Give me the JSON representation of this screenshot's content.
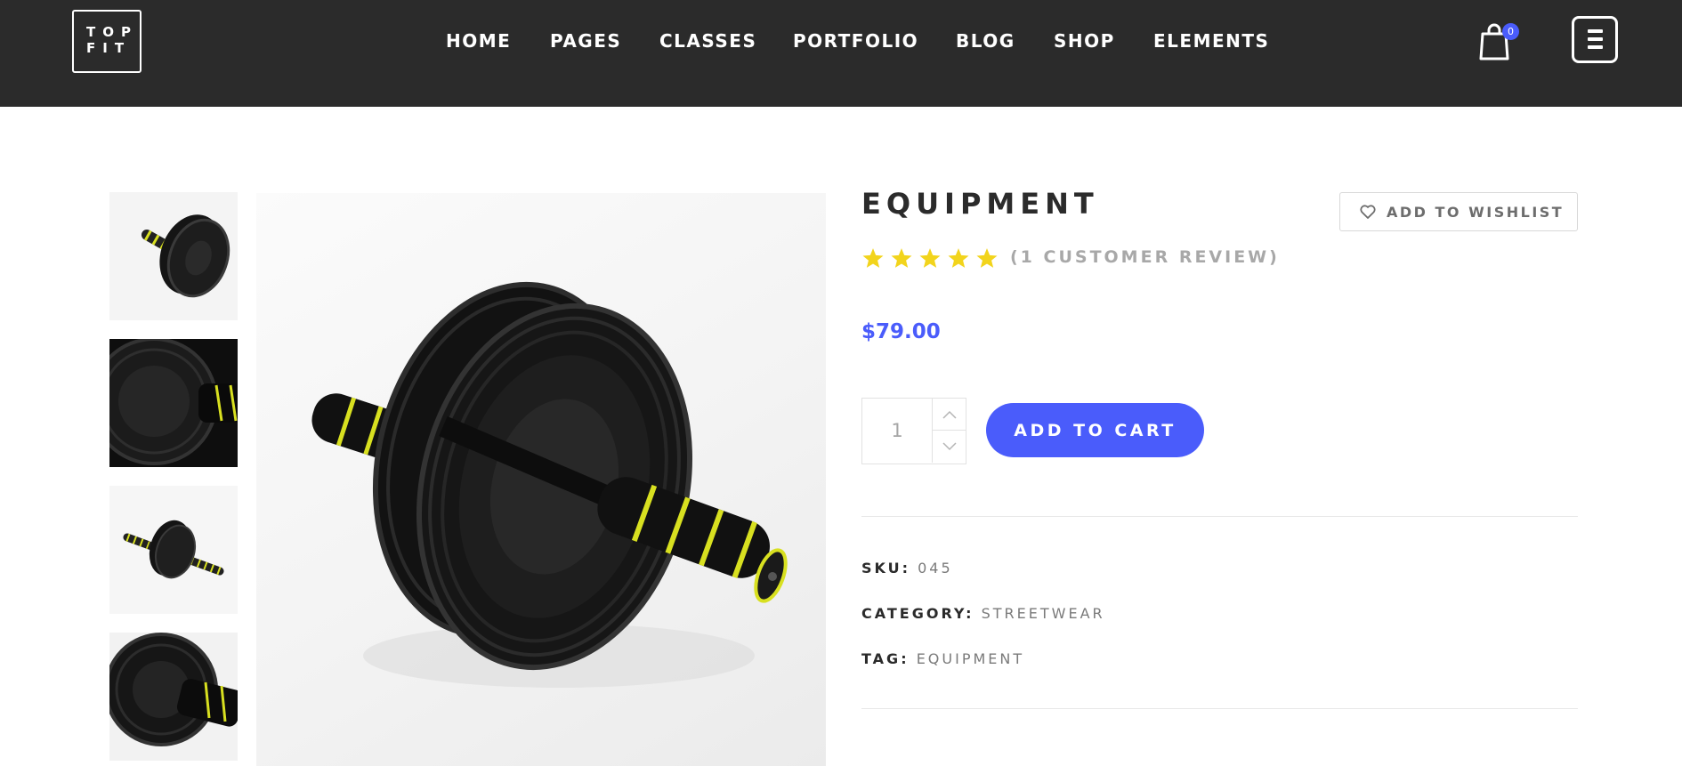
{
  "header": {
    "logo": {
      "line1": "TOP",
      "line2": "FIT"
    },
    "nav": [
      {
        "label": "HOME"
      },
      {
        "label": "PAGES"
      },
      {
        "label": "CLASSES"
      },
      {
        "label": "PORTFOLIO"
      },
      {
        "label": "BLOG"
      },
      {
        "label": "SHOP"
      },
      {
        "label": "ELEMENTS"
      }
    ],
    "cart_count": "0",
    "icons": {
      "cart": "shopping-bag-icon",
      "menu": "hamburger-menu-icon"
    }
  },
  "gallery": {
    "thumbnails": [
      "ab-wheel-thumb-1",
      "ab-wheel-thumb-2",
      "ab-wheel-thumb-3",
      "ab-wheel-thumb-4"
    ],
    "main_image": "ab-wheel-roller"
  },
  "product": {
    "title": "EQUIPMENT",
    "wishlist_label": "ADD TO WISHLIST",
    "rating": 5,
    "rating_max": 5,
    "review_text": "(1 CUSTOMER REVIEW)",
    "price": "$79.00",
    "quantity": "1",
    "add_to_cart_label": "ADD TO CART",
    "meta": {
      "sku_label": "SKU:",
      "sku_value": "045",
      "category_label": "CATEGORY:",
      "category_value": "STREETWEAR",
      "tag_label": "TAG:",
      "tag_value": "EQUIPMENT"
    }
  },
  "colors": {
    "header_bg": "#2b2b2b",
    "accent": "#4a5cfb",
    "star": "#f2d41c"
  }
}
